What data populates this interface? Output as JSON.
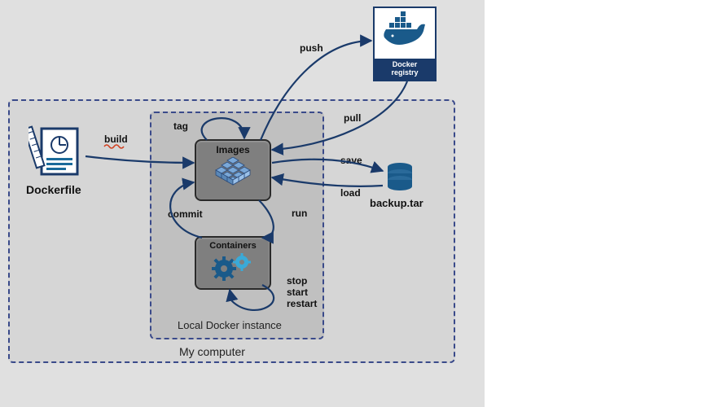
{
  "diagram": {
    "outer_box_label": "My computer",
    "inner_box_label": "Local Docker instance",
    "nodes": {
      "dockerfile": "Dockerfile",
      "images": "Images",
      "containers": "Containers",
      "registry_line1": "Docker",
      "registry_line2": "registry",
      "backup": "backup.tar"
    },
    "edges": {
      "build": "build",
      "tag": "tag",
      "push": "push",
      "pull": "pull",
      "save": "save",
      "load": "load",
      "run": "run",
      "commit": "commit",
      "stop": "stop",
      "start": "start",
      "restart": "restart"
    }
  }
}
